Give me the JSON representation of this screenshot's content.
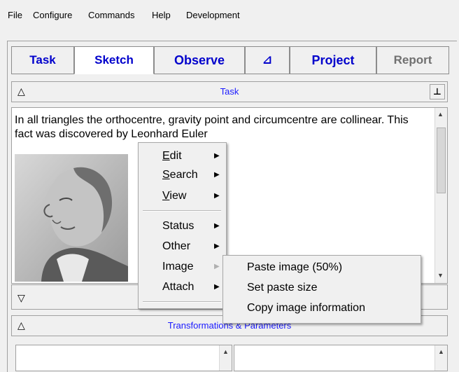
{
  "menubar": {
    "items": [
      "File",
      "Configure",
      "Commands",
      "Help",
      "Development"
    ]
  },
  "tabs": [
    {
      "label": "Task",
      "selected": false
    },
    {
      "label": "Sketch",
      "selected": true
    },
    {
      "label": "Observe",
      "selected": false
    },
    {
      "label": "⊿",
      "selected": false
    },
    {
      "label": "Project",
      "selected": false
    },
    {
      "label": "Report",
      "selected": false,
      "disabled": true
    }
  ],
  "task_panel": {
    "title": "Task",
    "text": "In all triangles the orthocentre, gravity point and circumcentre are collinear. This fact was discovered by Leonhard Euler"
  },
  "context_menu": {
    "items": [
      {
        "label": "Edit",
        "mnemonic": "E",
        "rest": "dit",
        "submenu": true
      },
      {
        "label": "Search",
        "mnemonic": "S",
        "rest": "earch",
        "submenu": true
      },
      {
        "label": "View",
        "mnemonic": "V",
        "rest": "iew",
        "submenu": true
      },
      {
        "label": "Status",
        "submenu": true
      },
      {
        "label": "Other",
        "submenu": true
      },
      {
        "label": "Image",
        "submenu": true,
        "active": true
      },
      {
        "label": "Attach",
        "submenu": true
      }
    ]
  },
  "image_submenu": {
    "items": [
      "Paste image (50%)",
      "Set paste size",
      "Copy image information"
    ]
  },
  "transform_panel": {
    "title": "Transformations & Parameters"
  },
  "colors": {
    "accent_blue": "#0000cc",
    "panel_title_blue": "#1a1aff",
    "disabled_gray": "#707070"
  }
}
